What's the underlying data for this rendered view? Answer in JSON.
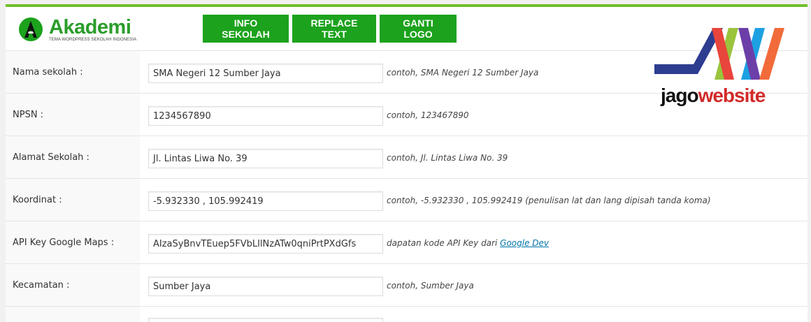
{
  "header": {
    "logo_name": "Akademi",
    "logo_tagline": "TEMA WORDPRESS SEKOLAH INDONESIA",
    "tabs": [
      {
        "label": "INFO SEKOLAH"
      },
      {
        "label": "REPLACE TEXT"
      },
      {
        "label": "GANTI LOGO"
      }
    ]
  },
  "watermark": {
    "part1": "jago",
    "part2": "website"
  },
  "form": {
    "rows": [
      {
        "label": "Nama sekolah :",
        "value": "SMA Negeri 12 Sumber Jaya",
        "hint": "contoh, SMA Negeri 12 Sumber Jaya"
      },
      {
        "label": "NPSN :",
        "value": "1234567890",
        "hint": "contoh, 123467890"
      },
      {
        "label": "Alamat Sekolah :",
        "value": "Jl. Lintas Liwa No. 39",
        "hint": "contoh, Jl. Lintas Liwa No. 39"
      },
      {
        "label": "Koordinat :",
        "value": "-5.932330 , 105.992419",
        "hint": "contoh, -5.932330 , 105.992419 (penulisan lat dan lang dipisah tanda koma)"
      },
      {
        "label": "API Key Google Maps :",
        "value": "AIzaSyBnvTEuep5FVbLIlNzATw0qniPrtPXdGfs",
        "hint": "dapatan kode API Key dari",
        "hint_link": "Google Dev"
      },
      {
        "label": "Kecamatan :",
        "value": "Sumber Jaya",
        "hint": "contoh, Sumber Jaya"
      }
    ]
  },
  "colors": {
    "accent_green": "#1ca21c",
    "top_bar": "#72c02c",
    "link": "#0073aa"
  }
}
